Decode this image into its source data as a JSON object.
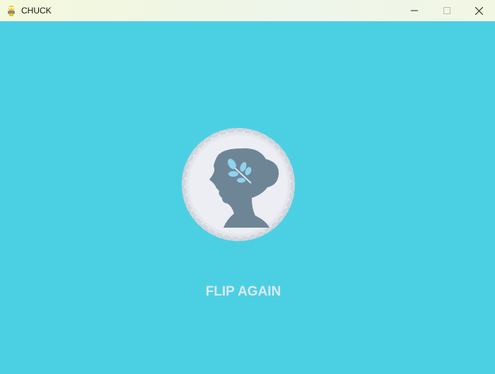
{
  "window": {
    "title": "CHUCK",
    "app_icon": "python-snake-icon"
  },
  "controls": {
    "minimize": "minimize-icon",
    "maximize": "maximize-icon",
    "close": "close-icon"
  },
  "game": {
    "background_color": "#4bd0e3",
    "coin": {
      "face": "heads",
      "icon": "coin-woman-profile-with-laurel-icon"
    },
    "flip_button_label": "FLIP AGAIN"
  }
}
